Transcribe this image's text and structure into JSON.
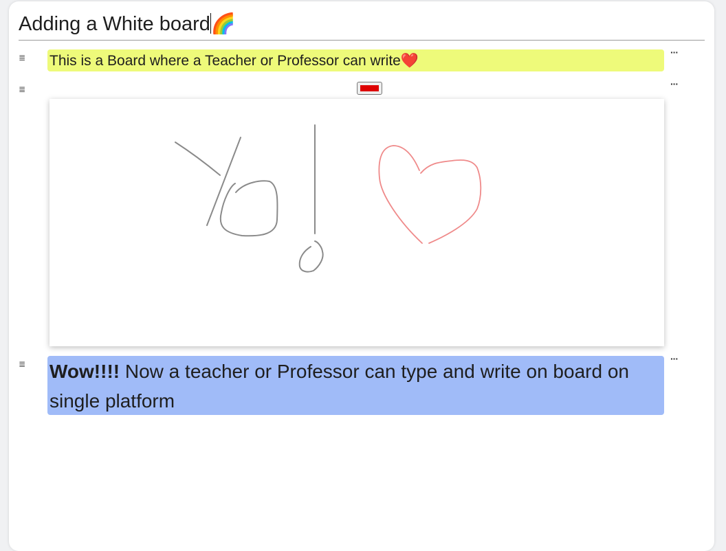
{
  "page": {
    "title": "Adding a White board",
    "title_emoji": "🌈"
  },
  "blocks": [
    {
      "type": "text",
      "text": "This is a Board where a Teacher or Professor can write",
      "emoji": "❤️",
      "background": "#eefa7a"
    },
    {
      "type": "whiteboard",
      "pen_color": "#dd0000",
      "drawing_label": "Yo! ♡"
    },
    {
      "type": "text",
      "bold_text": "Wow!!!!",
      "text": " Now a teacher or Professor can type and write on board on single platform",
      "background": "#a0bbf8"
    }
  ],
  "icons": {
    "drag_handle": "≣",
    "more": "···"
  },
  "colors": {
    "stroke_gray": "#8a8a8a",
    "stroke_pink": "#ef8a8a"
  }
}
